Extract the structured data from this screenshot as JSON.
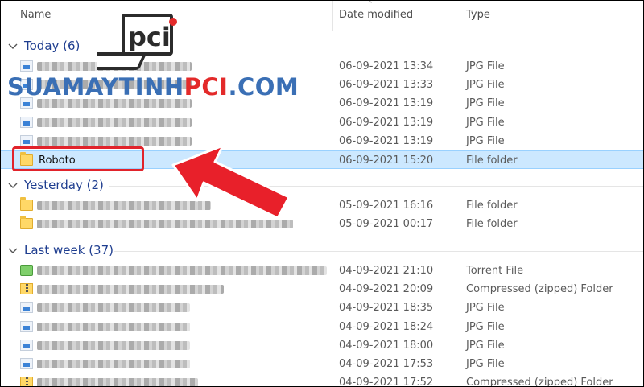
{
  "columns": {
    "name": "Name",
    "date_modified": "Date modified",
    "type": "Type"
  },
  "groups": [
    {
      "label": "Today (6)",
      "rows": [
        {
          "icon": "jpg",
          "date": "06-09-2021 13:34",
          "type": "JPG File"
        },
        {
          "icon": "jpg",
          "date": "06-09-2021 13:33",
          "type": "JPG File"
        },
        {
          "icon": "jpg",
          "date": "06-09-2021 13:19",
          "type": "JPG File"
        },
        {
          "icon": "jpg",
          "date": "06-09-2021 13:19",
          "type": "JPG File"
        },
        {
          "icon": "jpg",
          "date": "06-09-2021 13:19",
          "type": "JPG File"
        },
        {
          "icon": "folder",
          "name": "Roboto",
          "date": "06-09-2021 15:20",
          "type": "File folder",
          "selected": true
        }
      ]
    },
    {
      "label": "Yesterday (2)",
      "rows": [
        {
          "icon": "folder",
          "date": "05-09-2021 16:16",
          "type": "File folder"
        },
        {
          "icon": "folder",
          "date": "05-09-2021 00:17",
          "type": "File folder"
        }
      ]
    },
    {
      "label": "Last week (37)",
      "rows": [
        {
          "icon": "torrent",
          "date": "04-09-2021 21:10",
          "type": "Torrent File"
        },
        {
          "icon": "zip",
          "date": "04-09-2021 20:09",
          "type": "Compressed (zipped) Folder"
        },
        {
          "icon": "jpg",
          "date": "04-09-2021 18:35",
          "type": "JPG File"
        },
        {
          "icon": "jpg",
          "date": "04-09-2021 18:24",
          "type": "JPG File"
        },
        {
          "icon": "jpg",
          "date": "04-09-2021 18:00",
          "type": "JPG File"
        },
        {
          "icon": "jpg",
          "date": "04-09-2021 17:53",
          "type": "JPG File"
        },
        {
          "icon": "zip",
          "date": "04-09-2021 17:52",
          "type": "Compressed (zipped) Folder"
        }
      ]
    }
  ],
  "watermark": {
    "part1": "SUAMAYTINH",
    "part2": "PCI",
    "part3": ".COM",
    "logo_text": "pci"
  },
  "colors": {
    "highlight": "#e1232b",
    "selected_row": "#cce8ff",
    "group_label": "#1e3d8f",
    "watermark_blue": "#3a6fb5",
    "watermark_red": "#e32a2a"
  }
}
